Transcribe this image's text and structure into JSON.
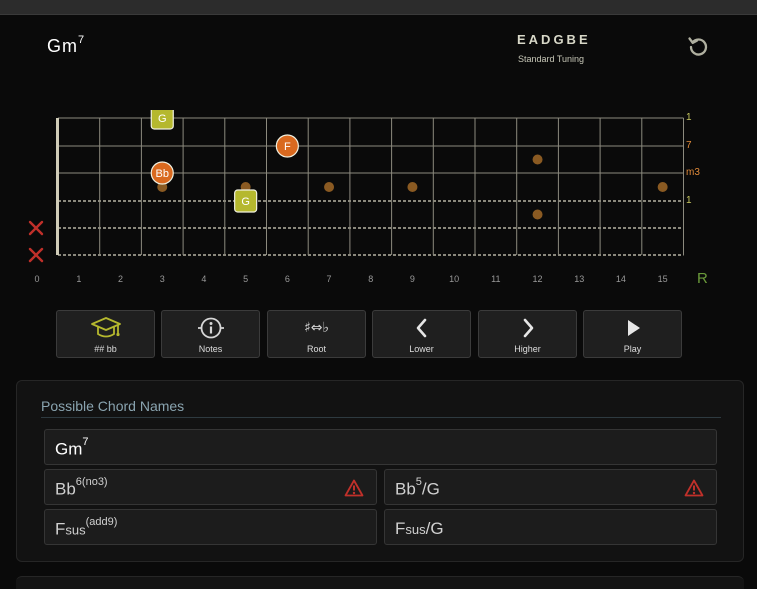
{
  "header": {
    "chord_root": "Gm",
    "chord_ext": "7",
    "tuning": "EADGBE",
    "tuning_name": "Standard Tuning"
  },
  "fretboard": {
    "fret_numbers": [
      "0",
      "1",
      "2",
      "3",
      "4",
      "5",
      "6",
      "7",
      "8",
      "9",
      "10",
      "11",
      "12",
      "13",
      "14",
      "15"
    ],
    "right_label": "R",
    "intervals": [
      {
        "text": "1",
        "color": "#c8c860"
      },
      {
        "text": "7",
        "color": "#e08a3a"
      },
      {
        "text": "m3",
        "color": "#e08a3a"
      },
      {
        "text": "1",
        "color": "#c8c860"
      }
    ],
    "notes": [
      {
        "label": "G",
        "string": 0,
        "fret": 3,
        "shape": "square",
        "color": "#b5b82e"
      },
      {
        "label": "F",
        "string": 1,
        "fret": 6,
        "shape": "circle",
        "color": "#d9691f"
      },
      {
        "label": "Bb",
        "string": 2,
        "fret": 3,
        "shape": "circle",
        "color": "#d9691f"
      },
      {
        "label": "G",
        "string": 3,
        "fret": 5,
        "shape": "square",
        "color": "#b5b82e"
      }
    ],
    "muted_strings": [
      4,
      5
    ],
    "inlays": [
      {
        "fret": 3,
        "string_gap": 2.5
      },
      {
        "fret": 5,
        "string_gap": 2.5
      },
      {
        "fret": 7,
        "string_gap": 2.5
      },
      {
        "fret": 9,
        "string_gap": 2.5
      },
      {
        "fret": 12,
        "string_gap": 1.5
      },
      {
        "fret": 12,
        "string_gap": 3.5
      },
      {
        "fret": 15,
        "string_gap": 2.5
      }
    ]
  },
  "toolbar": {
    "buttons": [
      {
        "label": "## bb",
        "icon": "graduation-cap-icon"
      },
      {
        "label": "Notes",
        "icon": "info-icon"
      },
      {
        "label": "Root",
        "icon": "sharp-flat-icon"
      },
      {
        "label": "Lower",
        "icon": "chevron-left-icon"
      },
      {
        "label": "Higher",
        "icon": "chevron-right-icon"
      },
      {
        "label": "Play",
        "icon": "play-icon"
      }
    ],
    "sharp_flat_glyph": "♯⇔♭"
  },
  "chord_names": {
    "title": "Possible Chord Names",
    "primary": {
      "root": "Gm",
      "sup": "7"
    },
    "alt1": {
      "root": "Bb",
      "sup": "6(no3)"
    },
    "alt2": {
      "root": "Bb",
      "sup": "5",
      "suffix": "/G"
    },
    "alt3": {
      "root": "F",
      "sub": "sus",
      "sup": "(add9)"
    },
    "alt4": {
      "root": "F",
      "sub": "sus",
      "suffix": "/G"
    }
  },
  "colors": {
    "accent_green": "#b5b82e",
    "accent_orange": "#d9691f",
    "warn_red": "#c0302a",
    "mute_red": "#c0302a"
  }
}
